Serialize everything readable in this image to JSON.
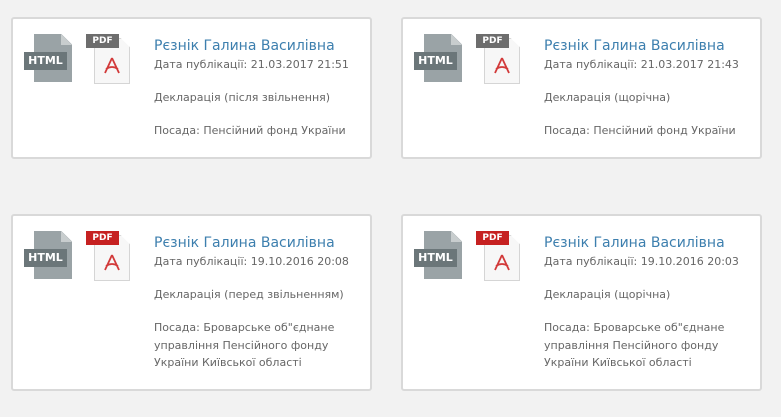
{
  "icons": {
    "html_label": "HTML",
    "pdf_label": "PDF"
  },
  "colors": {
    "link": "#3d7fae",
    "text_muted": "#666666",
    "pdf_tag_gray": "#6d6d6d",
    "pdf_tag_red": "#c62121",
    "html_tag": "#6b7679"
  },
  "cards": [
    {
      "name": "Рєзнік Галина Василівна",
      "date": "Дата публікації: 21.03.2017 21:51",
      "type": "Декларація (після звільнення)",
      "post": "Посада: Пенсійний фонд України",
      "pdf_style": "gray"
    },
    {
      "name": "Рєзнік Галина Василівна",
      "date": "Дата публікації: 21.03.2017 21:43",
      "type": "Декларація (щорічна)",
      "post": "Посада: Пенсійний фонд України",
      "pdf_style": "gray"
    },
    {
      "name": "Рєзнік Галина Василівна",
      "date": "Дата публікації: 19.10.2016 20:08",
      "type": "Декларація (перед звільненням)",
      "post": "Посада: Броварське об\"єднане управління Пенсійного фонду України Київської області",
      "pdf_style": "red"
    },
    {
      "name": "Рєзнік Галина Василівна",
      "date": "Дата публікації: 19.10.2016 20:03",
      "type": "Декларація (щорічна)",
      "post": "Посада: Броварське об\"єднане управління Пенсійного фонду України Київської області",
      "pdf_style": "red"
    }
  ]
}
